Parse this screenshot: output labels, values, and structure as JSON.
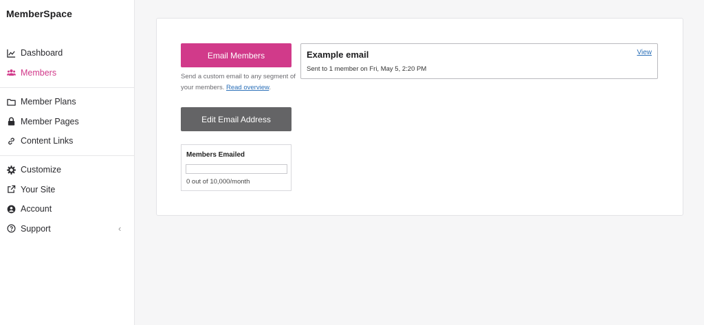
{
  "app": {
    "logo_text": "MemberSpace"
  },
  "sidebar": {
    "groups": [
      {
        "items": [
          {
            "label": "Dashboard",
            "icon": "chart-line-icon"
          },
          {
            "label": "Members",
            "icon": "users-icon",
            "active": true
          }
        ]
      },
      {
        "items": [
          {
            "label": "Member Plans",
            "icon": "folder-icon"
          },
          {
            "label": "Member Pages",
            "icon": "lock-icon"
          },
          {
            "label": "Content Links",
            "icon": "link-icon"
          }
        ]
      },
      {
        "items": [
          {
            "label": "Customize",
            "icon": "gear-icon"
          },
          {
            "label": "Your Site",
            "icon": "external-link-icon"
          },
          {
            "label": "Account",
            "icon": "user-circle-icon"
          },
          {
            "label": "Support",
            "icon": "question-circle-icon"
          }
        ]
      }
    ],
    "collapse_glyph": "‹"
  },
  "main": {
    "email_button_label": "Email Members",
    "help_text": "Send a custom email to any segment of your members.",
    "help_link": "Read overview",
    "help_suffix": ".",
    "edit_button_label": "Edit Email Address",
    "quota": {
      "title": "Members Emailed",
      "used_fraction": 0,
      "text": "0 out of 10,000/month"
    },
    "email_card": {
      "title": "Example email",
      "subtitle": "Sent to 1 member on Fri, May 5, 2:20 PM",
      "view_label": "View"
    }
  },
  "colors": {
    "accent": "#d13a8a",
    "secondary_button": "#646466",
    "link": "#2a6fb8"
  }
}
